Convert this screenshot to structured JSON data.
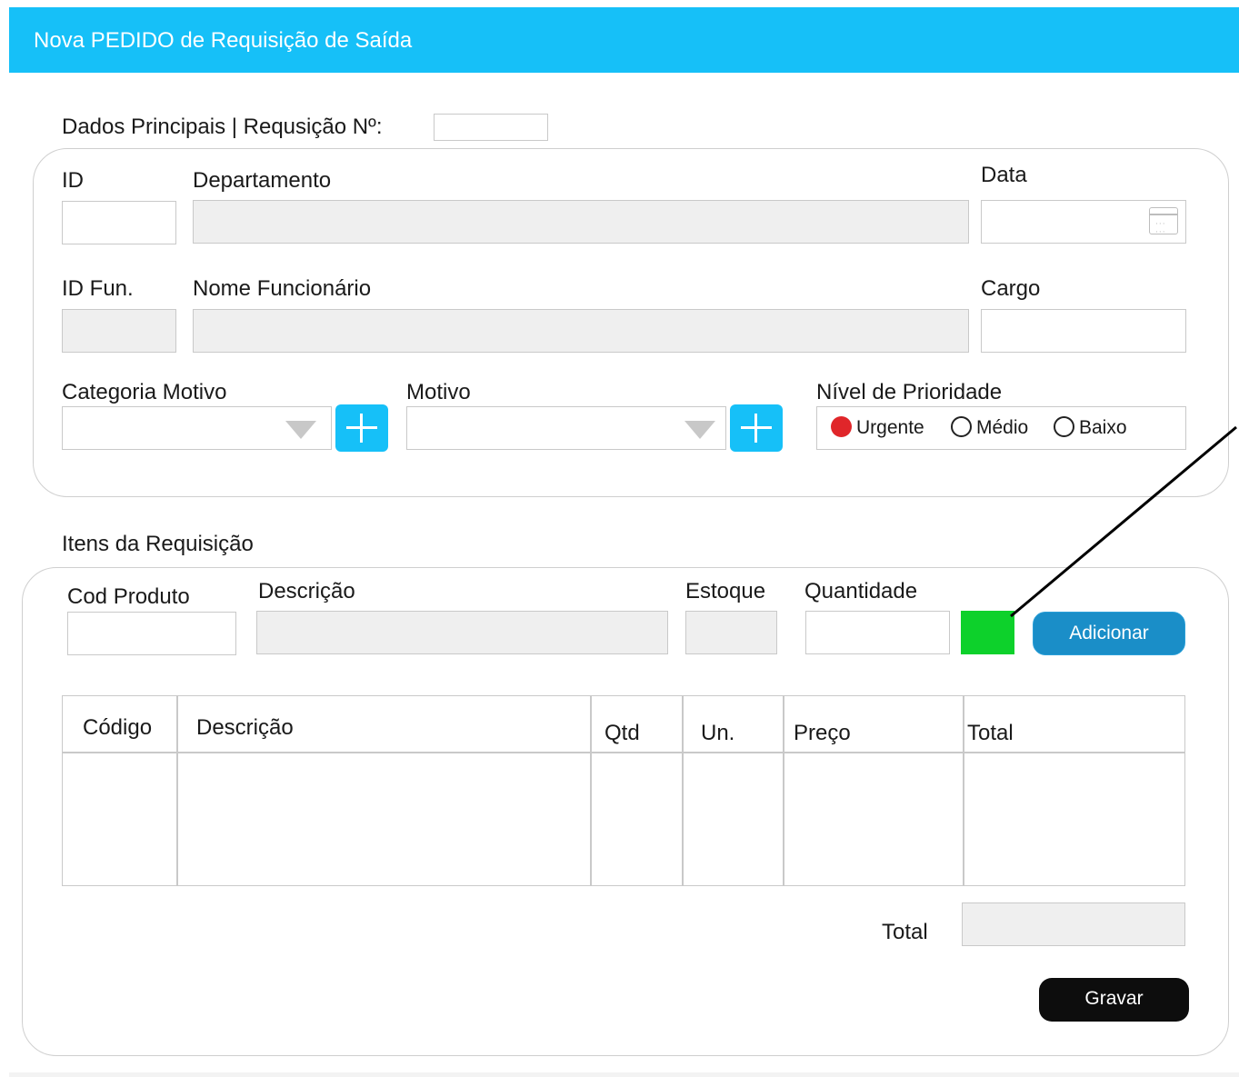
{
  "window": {
    "title": "Nova PEDIDO de Requisição de Saída"
  },
  "main_data": {
    "section_title": "Dados Principais | Requsição Nº:",
    "requisition_number": "",
    "labels": {
      "id": "ID",
      "department": "Departamento",
      "date": "Data",
      "employee_id": "ID Fun.",
      "employee_name": "Nome Funcionário",
      "position": "Cargo",
      "reason_category": "Categoria Motivo",
      "reason": "Motivo",
      "priority": "Nível de Prioridade"
    },
    "values": {
      "id": "",
      "department": "",
      "date": "",
      "employee_id": "",
      "employee_name": "",
      "position": "",
      "reason_category": "",
      "reason": ""
    },
    "priority_options": [
      "Urgente",
      "Médio",
      "Baixo"
    ],
    "priority_selected": "Urgente",
    "colors": {
      "selected_radio": "#e0262a",
      "add_buttons": "#16c0f8"
    }
  },
  "items": {
    "section_title": "Itens da Requisição",
    "labels": {
      "product_code": "Cod Produto",
      "description": "Descrição",
      "stock": "Estoque",
      "quantity": "Quantidade"
    },
    "values": {
      "product_code": "",
      "description": "",
      "stock": "",
      "quantity": ""
    },
    "add_button": "Adicionar",
    "status_indicator_color": "#0dd12b",
    "table": {
      "columns": [
        "Código",
        "Descrição",
        "Qtd",
        "Un.",
        "Preço",
        "Total"
      ],
      "rows": []
    },
    "total_label": "Total",
    "total_value": "",
    "save_button": "Gravar"
  },
  "colors": {
    "title_bar": "#16c0f8",
    "add_item_button": "#1a8ec8",
    "save_button": "#0d0d0d"
  }
}
